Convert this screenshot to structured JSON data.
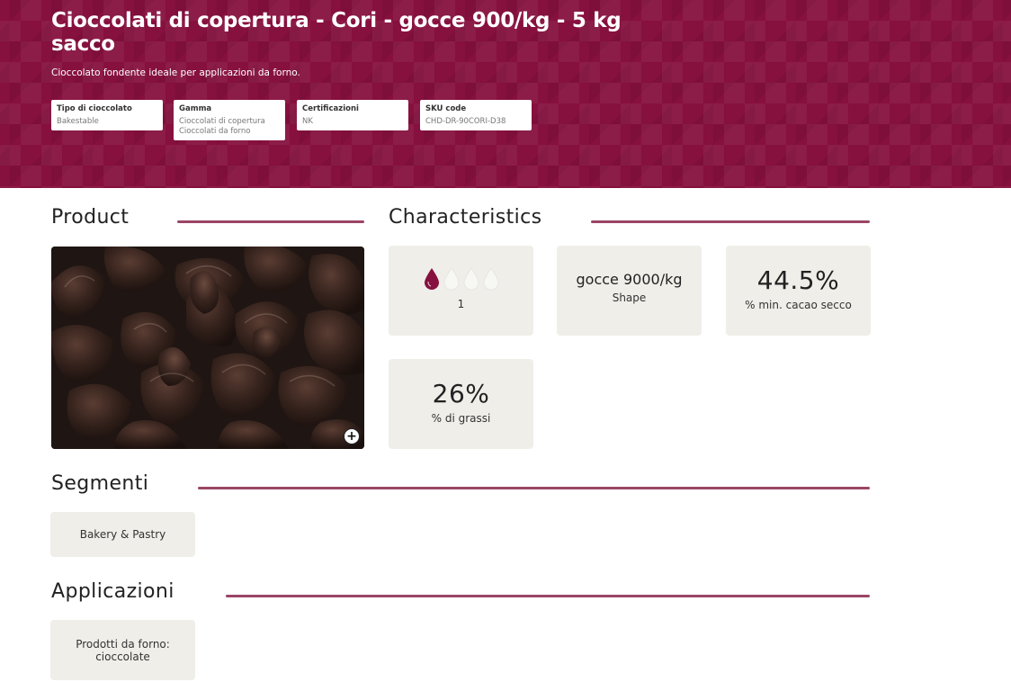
{
  "header": {
    "title": "Cioccolati di copertura - Cori - gocce 900/kg - 5 kg sacco",
    "subtitle": "Cioccolato fondente ideale per applicazioni da forno.",
    "specs": [
      {
        "label": "Tipo di cioccolato",
        "value": "Bakestable"
      },
      {
        "label": "Gamma",
        "value": "Cioccolati di copertura Cioccolati da forno"
      },
      {
        "label": "Certificazioni",
        "value": "NK"
      },
      {
        "label": "SKU code",
        "value": "CHD-DR-90CORI-D38"
      }
    ],
    "accent_color": "#86103e"
  },
  "product": {
    "heading": "Product",
    "zoom_icon": "zoom-in-icon"
  },
  "characteristics": {
    "heading": "Characteristics",
    "fluidity": {
      "level": 1,
      "max": 4,
      "label": "1",
      "icon": "drop-icon"
    },
    "shape": {
      "value": "gocce 9000/kg",
      "label": "Shape"
    },
    "cacao": {
      "value": "44.5%",
      "label": "% min. cacao secco"
    },
    "fat": {
      "value": "26%",
      "label": "% di grassi"
    }
  },
  "segmenti": {
    "heading": "Segmenti",
    "items": [
      "Bakery & Pastry"
    ]
  },
  "applicazioni": {
    "heading": "Applicazioni",
    "items": [
      "Prodotti da forno: cioccolate"
    ]
  }
}
